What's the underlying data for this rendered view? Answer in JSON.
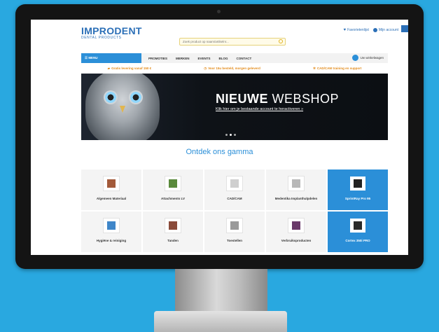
{
  "header": {
    "logo_main": "IMPRODENT",
    "logo_sub": "DENTAL PRODUCTS",
    "search_placeholder": "Zoek product op naam/artikelnr...",
    "favorites": "Favorietenlijst",
    "account": "Mijn account"
  },
  "nav": {
    "menu": "MENU",
    "items": [
      "PROMOTIES",
      "MERKEN",
      "EVENTS",
      "BLOG",
      "CONTACT"
    ],
    "cart": "Uw winkelwagen"
  },
  "usps": [
    "Gratis levering vanaf 150 €",
    "Voor 15u besteld, morgen geleverd",
    "CAD/CAM training en support"
  ],
  "banner": {
    "title_bold": "NIEUWE",
    "title_light": "WEBSHOP",
    "subtitle": "Klik hier om je bestaande account te heractiveren »"
  },
  "section_title": "Ontdek ons gamma",
  "categories": [
    {
      "label": "Algemeen Materiaal",
      "highlight": false,
      "color": "#a35a3a"
    },
    {
      "label": "Attachments LV",
      "highlight": false,
      "color": "#5a8a3c"
    },
    {
      "label": "CAD/CAM",
      "highlight": false,
      "color": "#cfcfcf"
    },
    {
      "label": "Medentika Implanthulpdelen",
      "highlight": false,
      "color": "#b8b8b8"
    },
    {
      "label": "SprintRay Pro 95",
      "highlight": true,
      "color": "#222222"
    },
    {
      "label": "Hygiëne & reiniging",
      "highlight": false,
      "color": "#3f86c9"
    },
    {
      "label": "Tanden",
      "highlight": false,
      "color": "#8a4b3a"
    },
    {
      "label": "Toestellen",
      "highlight": false,
      "color": "#9a9a9a"
    },
    {
      "label": "Verbruiksproducten",
      "highlight": false,
      "color": "#6a3a6a"
    },
    {
      "label": "Cortex 350i PRO",
      "highlight": true,
      "color": "#2a2a2a"
    }
  ],
  "colors": {
    "accent": "#2b8fd8",
    "logo": "#2b6fb7",
    "usp": "#e38a18",
    "background": "#29a8e0"
  }
}
